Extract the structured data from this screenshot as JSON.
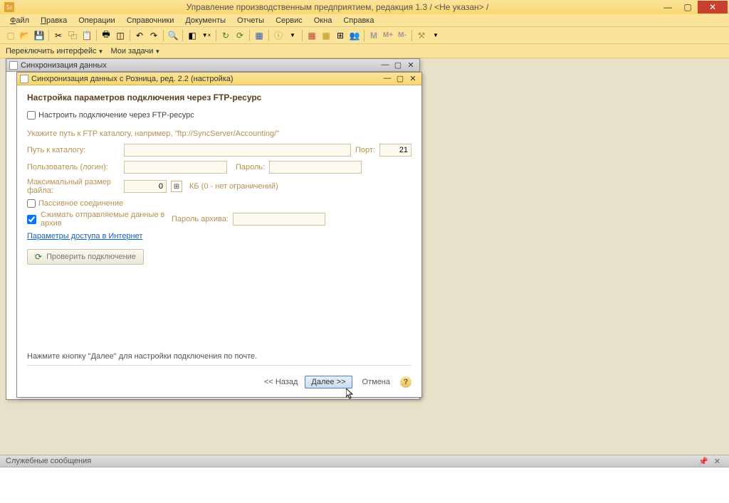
{
  "title": "Управление производственным предприятием, редакция 1.3 / <Не указан> /",
  "menu": {
    "file": "Файл",
    "edit": "Правка",
    "ops": "Операции",
    "refs": "Справочники",
    "docs": "Документы",
    "reports": "Отчеты",
    "service": "Сервис",
    "windows": "Окна",
    "help": "Справка"
  },
  "switch": {
    "interface": "Переключить интерфейс",
    "tasks": "Мои задачи"
  },
  "inner": {
    "title": "Синхронизация данных"
  },
  "wizard": {
    "title": "Синхронизация данных с Розница, ред. 2.2 (настройка)",
    "heading": "Настройка параметров подключения через FTP-ресурс",
    "checkbox_ftp": "Настроить подключение через FTP-ресурс",
    "hint": "Укажите путь к FTP каталогу, например, \"ftp://SyncServer/Accounting/\"",
    "path_label": "Путь к каталогу:",
    "port_label": "Порт:",
    "port_value": "21",
    "user_label": "Пользователь (логин):",
    "pass_label": "Пароль:",
    "maxsize_label": "Максимальный размер файла:",
    "maxsize_value": "0",
    "kb_hint": "КБ   (0 - нет ограничений)",
    "passive": "Пассивное соединение",
    "compress": "Сжимать отправляемые данные в архив",
    "archive_pass_label": "Пароль архива:",
    "internet_link": "Параметры доступа в Интернет",
    "test_btn": "Проверить подключение",
    "footer_hint": "Нажмите кнопку \"Далее\" для настройки подключения по почте.",
    "back": "<< Назад",
    "next": "Далее >>",
    "cancel": "Отмена"
  },
  "status": {
    "title": "Служебные сообщения"
  }
}
